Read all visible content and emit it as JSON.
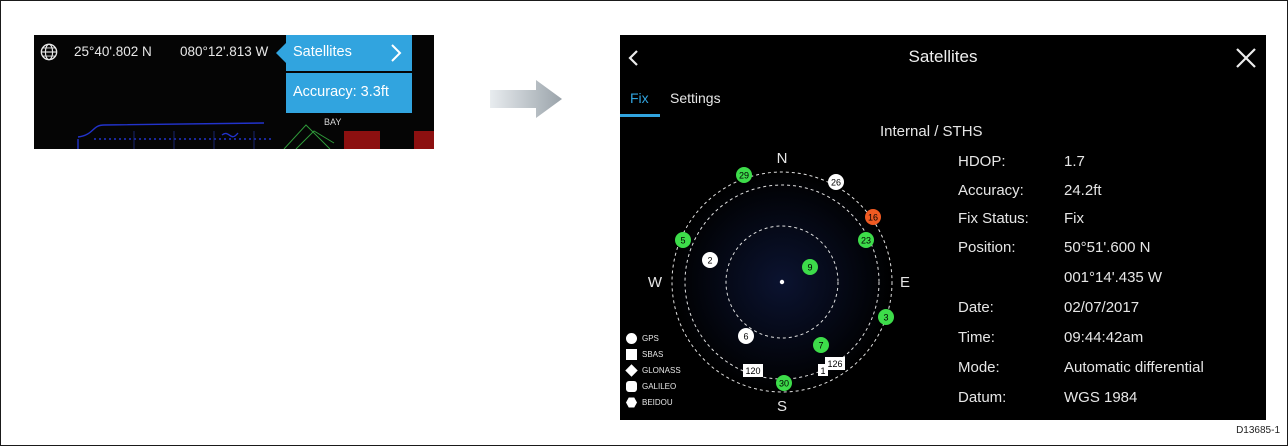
{
  "nav_bar": {
    "latitude": "25°40'.802 N",
    "longitude": "080°12'.813 W",
    "popup_satellites_label": "Satellites",
    "popup_accuracy_label": "Accuracy: 3.3ft"
  },
  "colors": {
    "accent": "#31a4df",
    "gps_sat_green": "#3ddc4a",
    "warning_sat_orange": "#f05a22"
  },
  "screen": {
    "title": "Satellites",
    "tabs": [
      {
        "label": "Fix",
        "active": true
      },
      {
        "label": "Settings",
        "active": false
      }
    ],
    "source": "Internal / STHS",
    "info": [
      {
        "key": "HDOP:",
        "value": "1.7"
      },
      {
        "key": "Accuracy:",
        "value": "24.2ft"
      },
      {
        "key": "Fix Status:",
        "value": "Fix"
      },
      {
        "key": "Position:",
        "value": "50°51'.600 N"
      },
      {
        "key": "",
        "value": "001°14'.435 W"
      },
      {
        "key": "Date:",
        "value": "02/07/2017"
      },
      {
        "key": "Time:",
        "value": "09:44:42am"
      },
      {
        "key": "Mode:",
        "value": "Automatic differential"
      },
      {
        "key": "Datum:",
        "value": "WGS 1984"
      }
    ],
    "compass": {
      "n": "N",
      "e": "E",
      "s": "S",
      "w": "W"
    },
    "satellites": [
      {
        "id": "29",
        "type": "circle",
        "color": "green"
      },
      {
        "id": "26",
        "type": "circle",
        "color": "white"
      },
      {
        "id": "16",
        "type": "circle",
        "color": "orange"
      },
      {
        "id": "23",
        "type": "circle",
        "color": "green"
      },
      {
        "id": "5",
        "type": "circle",
        "color": "green"
      },
      {
        "id": "2",
        "type": "circle",
        "color": "white"
      },
      {
        "id": "9",
        "type": "circle",
        "color": "green"
      },
      {
        "id": "3",
        "type": "circle",
        "color": "green"
      },
      {
        "id": "6",
        "type": "circle",
        "color": "white"
      },
      {
        "id": "7",
        "type": "circle",
        "color": "green"
      },
      {
        "id": "120",
        "type": "square",
        "color": "white"
      },
      {
        "id": "126",
        "type": "square",
        "color": "white"
      },
      {
        "id": "1",
        "type": "square",
        "color": "white"
      },
      {
        "id": "30",
        "type": "circle",
        "color": "green"
      }
    ],
    "legend": [
      {
        "label": "GPS",
        "shape": "circle"
      },
      {
        "label": "SBAS",
        "shape": "square"
      },
      {
        "label": "GLONASS",
        "shape": "diamond"
      },
      {
        "label": "GALILEO",
        "shape": "rounded-square"
      },
      {
        "label": "BEIDOU",
        "shape": "hexagon"
      }
    ]
  },
  "figure_code": "D13685-1"
}
